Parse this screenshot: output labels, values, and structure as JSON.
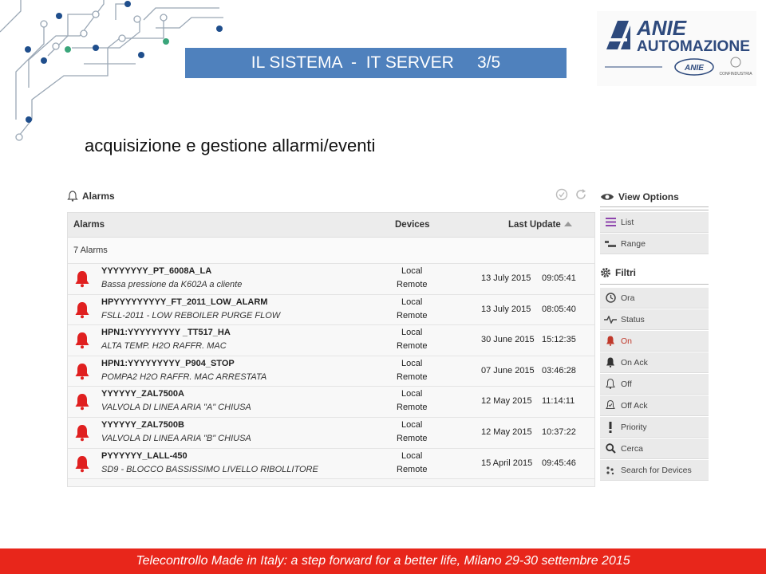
{
  "slide": {
    "title": "IL SISTEMA  -  IT SERVER     3/5",
    "subtitle": "acquisizione e gestione allarmi/eventi",
    "footer": "Telecontrollo Made in Italy: a step forward for a better life, Milano 29-30 settembre 2015",
    "logo": {
      "brand_top": "ANIE",
      "brand_bottom": "AUTOMAZIONE",
      "badge": "ANIE",
      "confederation": "CONFINDUSTRIA"
    }
  },
  "alarms_panel": {
    "title": "Alarms",
    "columns": {
      "alarms": "Alarms",
      "devices": "Devices",
      "last_update": "Last Update"
    },
    "count_label": "7 Alarms",
    "rows": [
      {
        "name": "YYYYYYYY_PT_6008A_LA",
        "description": "Bassa pressione da K602A a cliente",
        "device_local": "Local",
        "device_remote": "Remote",
        "date": "13 July 2015",
        "time": "09:05:41"
      },
      {
        "name": "HPYYYYYYYYY_FT_2011_LOW_ALARM",
        "description": "FSLL-2011 - LOW REBOILER PURGE FLOW",
        "device_local": "Local",
        "device_remote": "Remote",
        "date": "13 July 2015",
        "time": "08:05:40"
      },
      {
        "name": "HPN1:YYYYYYYYY _TT517_HA",
        "description": "ALTA TEMP. H2O RAFFR. MAC",
        "device_local": "Local",
        "device_remote": "Remote",
        "date": "30 June 2015",
        "time": "15:12:35"
      },
      {
        "name": "HPN1:YYYYYYYYY_P904_STOP",
        "description": "POMPA2 H2O RAFFR. MAC ARRESTATA",
        "device_local": "Local",
        "device_remote": "Remote",
        "date": "07 June 2015",
        "time": "03:46:28"
      },
      {
        "name": "YYYYYY_ZAL7500A",
        "description": "VALVOLA DI LINEA ARIA \"A\" CHIUSA",
        "device_local": "Local",
        "device_remote": "Remote",
        "date": "12 May 2015",
        "time": "11:14:11"
      },
      {
        "name": "YYYYYY_ZAL7500B",
        "description": "VALVOLA DI LINEA ARIA \"B\" CHIUSA",
        "device_local": "Local",
        "device_remote": "Remote",
        "date": "12 May 2015",
        "time": "10:37:22"
      },
      {
        "name": "PYYYYYY_LALL-450",
        "description": "SD9 - BLOCCO BASSISSIMO LIVELLO RIBOLLITORE",
        "device_local": "Local",
        "device_remote": "Remote",
        "date": "15 April 2015",
        "time": "09:45:46"
      }
    ]
  },
  "view_options": {
    "title": "View Options",
    "items": [
      {
        "label": "List",
        "icon": "list-icon"
      },
      {
        "label": "Range",
        "icon": "range-icon"
      }
    ]
  },
  "filters": {
    "title": "Filtri",
    "items": [
      {
        "label": "Ora",
        "icon": "clock-icon"
      },
      {
        "label": "Status",
        "icon": "pulse-icon"
      },
      {
        "label": "On",
        "icon": "bell-on-icon"
      },
      {
        "label": "On Ack",
        "icon": "bell-ack-icon"
      },
      {
        "label": "Off",
        "icon": "bell-off-icon"
      },
      {
        "label": "Off Ack",
        "icon": "bell-off-ack-icon"
      },
      {
        "label": "Priority",
        "icon": "exclamation-icon"
      },
      {
        "label": "Cerca",
        "icon": "search-icon"
      },
      {
        "label": "Search for Devices",
        "icon": "devices-icon"
      }
    ]
  },
  "colors": {
    "title_bar": "#4f81bd",
    "footer": "#e8261b",
    "alarm_bell": "#e02020",
    "accent_on": "#c0392b",
    "logo_blue": "#2e4a7d"
  }
}
